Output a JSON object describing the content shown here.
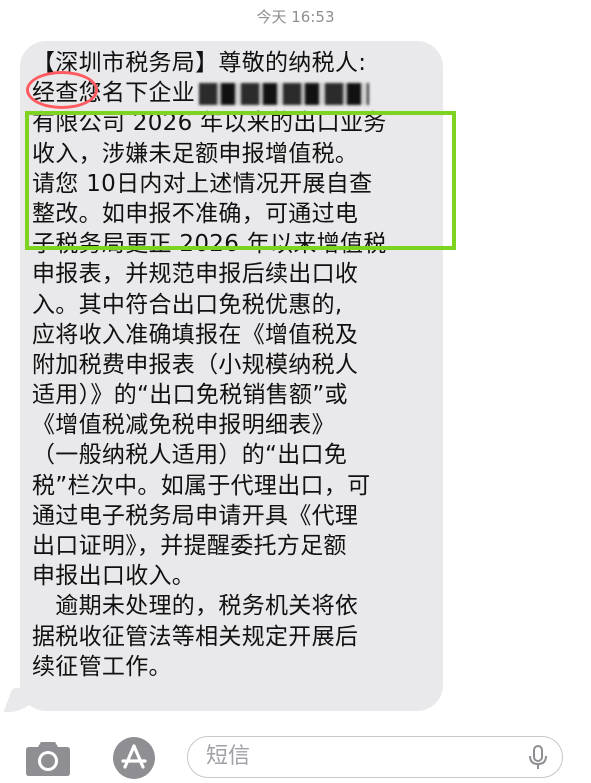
{
  "header": {
    "timestamp": "今天 16:53"
  },
  "message": {
    "lines": [
      "【深圳市税务局】尊敬的纳税人:",
      "经查您名下企业",
      "有限公司 2026 年以来的出口业务",
      "收入，涉嫌未足额申报增值税。",
      "请您 10日内对上述情况开展自查",
      "整改。如申报不准确，可通过电",
      "子税务局更正 2026 年以来增值税",
      "申报表，并规范申报后续出口收",
      "入。其中符合出口免税优惠的,",
      "应将收入准确填报在《增值税及",
      "附加税费申报表（小规模纳税人",
      "适用）》的“出口免税销售额”或",
      "《增值税减免税申报明细表》",
      "（一般纳税人适用）的“出口免",
      "税”栏次中。如属于代理出口，可",
      "通过电子税务局申请开具《代理",
      "出口证明》，并提醒委托方足额",
      "申报出口收入。",
      "　逾期未处理的，税务机关将依",
      "据税收征管法等相关规定开展后",
      "续征管工作。"
    ]
  },
  "composer": {
    "placeholder": "短信"
  },
  "colors": {
    "bubble": "#e9e9eb",
    "highlight": "#7ed321",
    "circle": "#ff5a5f"
  },
  "icons": [
    "camera-icon",
    "app-store-icon",
    "microphone-icon"
  ]
}
